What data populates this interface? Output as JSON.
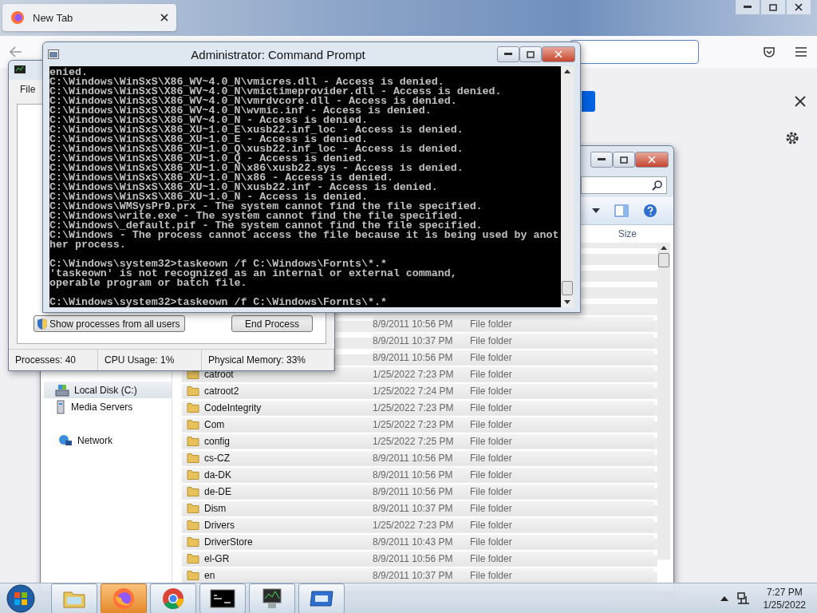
{
  "browser": {
    "tabs": [
      {
        "title": "New Tab",
        "selected": true
      }
    ]
  },
  "explorer": {
    "column_header": "Size",
    "nav": [
      {
        "label": "Local Disk (C:)",
        "kind": "disk",
        "selected": true
      },
      {
        "label": "Media Servers",
        "kind": "server",
        "selected": false
      },
      {
        "label": "Network",
        "kind": "network",
        "selected": false
      }
    ],
    "rows": [
      {
        "date": "8/9/2011 10:56 PM",
        "type": "File folder"
      },
      {
        "date": "8/9/2011 10:37 PM",
        "type": "File folder"
      },
      {
        "date": "8/9/2011 10:56 PM",
        "type": "File folder"
      },
      {
        "name": "catroot",
        "date": "1/25/2022 7:23 PM",
        "type": "File folder"
      },
      {
        "name": "catroot2",
        "date": "1/25/2022 7:24 PM",
        "type": "File folder"
      },
      {
        "name": "CodeIntegrity",
        "date": "1/25/2022 7:23 PM",
        "type": "File folder"
      },
      {
        "name": "Com",
        "date": "1/25/2022 7:23 PM",
        "type": "File folder"
      },
      {
        "name": "config",
        "date": "1/25/2022 7:25 PM",
        "type": "File folder"
      },
      {
        "name": "cs-CZ",
        "date": "8/9/2011 10:56 PM",
        "type": "File folder"
      },
      {
        "name": "da-DK",
        "date": "8/9/2011 10:56 PM",
        "type": "File folder"
      },
      {
        "name": "de-DE",
        "date": "8/9/2011 10:56 PM",
        "type": "File folder"
      },
      {
        "name": "Dism",
        "date": "8/9/2011 10:37 PM",
        "type": "File folder"
      },
      {
        "name": "Drivers",
        "date": "1/25/2022 7:23 PM",
        "type": "File folder"
      },
      {
        "name": "DriverStore",
        "date": "8/9/2011 10:43 PM",
        "type": "File folder"
      },
      {
        "name": "el-GR",
        "date": "8/9/2011 10:56 PM",
        "type": "File folder"
      },
      {
        "name": "en",
        "date": "8/9/2011 10:37 PM",
        "type": "File folder"
      }
    ]
  },
  "task_manager": {
    "menu": [
      "File"
    ],
    "buttons": [
      {
        "label": "Show processes from all users",
        "kind": "shield"
      },
      {
        "label": "End Process",
        "kind": "plain"
      }
    ],
    "status_bar": [
      "Processes: 40",
      "CPU Usage: 1%",
      "Physical Memory: 33%"
    ]
  },
  "command_prompt": {
    "title": "Administrator: Command Prompt",
    "blocks": [
      {
        "lines": [
          "enied.",
          "C:\\Windows\\WinSxS\\X86_WV~4.0_N\\vmicres.dll - Access is denied.",
          "C:\\Windows\\WinSxS\\X86_WV~4.0_N\\vmictimeprovider.dll - Access is denied.",
          "C:\\Windows\\WinSxS\\X86_WV~4.0_N\\vmrdvcore.dll - Access is denied.",
          "C:\\Windows\\WinSxS\\X86_WV~4.0_N\\wvmic.inf - Access is denied.",
          "C:\\Windows\\WinSxS\\X86_WV~4.0_N - Access is denied.",
          "C:\\Windows\\WinSxS\\X86_XU~1.0_E\\xusb22.inf_loc - Access is denied.",
          "C:\\Windows\\WinSxS\\X86_XU~1.0_E - Access is denied.",
          "C:\\Windows\\WinSxS\\X86_XU~1.0_Q\\xusb22.inf_loc - Access is denied.",
          "C:\\Windows\\WinSxS\\X86_XU~1.0_Q - Access is denied.",
          "C:\\Windows\\WinSxS\\X86_XU~1.0_N\\x86\\xusb22.sys - Access is denied.",
          "C:\\Windows\\WinSxS\\X86_XU~1.0_N\\x86 - Access is denied.",
          "C:\\Windows\\WinSxS\\X86_XU~1.0_N\\xusb22.inf - Access is denied.",
          "C:\\Windows\\WinSxS\\X86_XU~1.0_N - Access is denied.",
          "C:\\Windows\\WMSysPr9.prx - The system cannot find the file specified.",
          "C:\\Windows\\write.exe - The system cannot find the file specified.",
          "C:\\Windows\\_default.pif - The system cannot find the file specified.",
          "C:\\Windows - The process cannot access the file because it is being used by anot",
          "her process."
        ]
      },
      {
        "lines": [
          "C:\\Windows\\system32>taskeown /f C:\\Windows\\Fornts\\*.*",
          "'taskeown' is not recognized as an internal or external command,",
          "operable program or batch file."
        ]
      },
      {
        "lines": [
          "C:\\Windows\\system32>taskeown /f C:\\Windows\\Fornts\\*.*"
        ]
      }
    ]
  },
  "taskbar": {
    "apps": [
      {
        "kind": "explorer",
        "selected": false
      },
      {
        "kind": "firefox",
        "selected": true
      },
      {
        "kind": "chrome",
        "selected": false
      },
      {
        "kind": "console",
        "selected": false
      },
      {
        "kind": "monitor",
        "selected": false
      },
      {
        "kind": "window",
        "selected": false
      }
    ],
    "time": "7:27 PM",
    "date": "1/25/2022"
  }
}
